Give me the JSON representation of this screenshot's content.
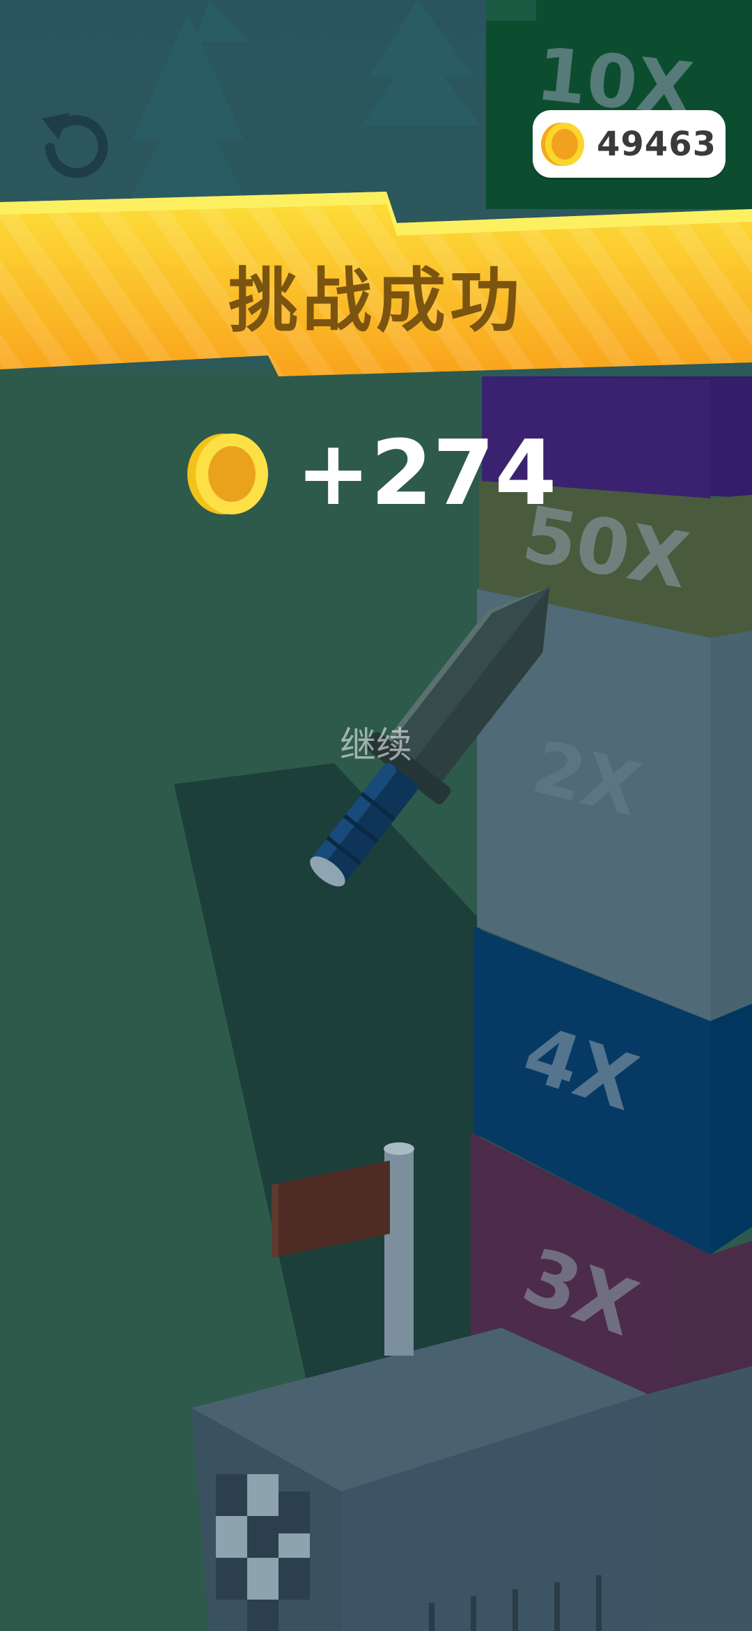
{
  "hud": {
    "coin_balance": "49463",
    "restart_icon": "restart-icon",
    "coin_icon": "gold-coin-icon"
  },
  "result": {
    "title": "挑战成功",
    "reward": "+274",
    "continue_label": "继续"
  },
  "tower": {
    "multipliers": [
      "10X",
      "50X",
      "2X",
      "4X",
      "3X"
    ]
  },
  "colors": {
    "banner_yellow": "#fcd432",
    "banner_orange": "#f9a11c",
    "coin_gold": "#fcc21b",
    "background_teal": "#2b4d52",
    "background_green": "#2f5a4a"
  }
}
